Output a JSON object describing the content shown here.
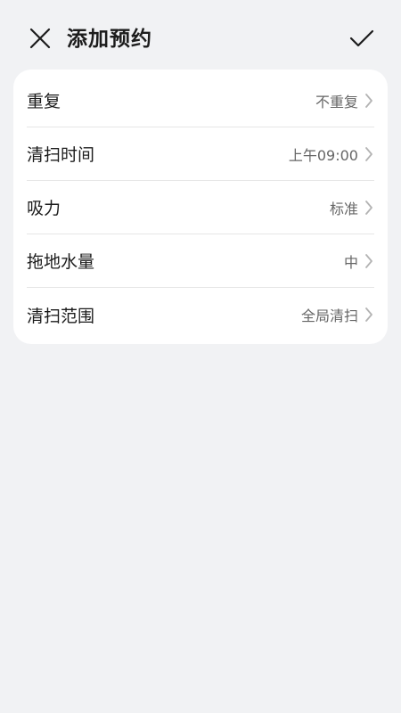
{
  "header": {
    "title": "添加预约",
    "close_icon": "close-icon",
    "confirm_icon": "checkmark-icon"
  },
  "settings": {
    "items": [
      {
        "label": "重复",
        "value": "不重复"
      },
      {
        "label": "清扫时间",
        "value": "上午09:00"
      },
      {
        "label": "吸力",
        "value": "标准"
      },
      {
        "label": "拖地水量",
        "value": "中"
      },
      {
        "label": "清扫范围",
        "value": "全局清扫"
      }
    ]
  },
  "colors": {
    "background": "#f1f2f4",
    "card": "#ffffff",
    "text_primary": "#1c1c1c",
    "text_secondary": "#666666",
    "divider": "#e6e6e6",
    "chevron": "#b3b3b3"
  }
}
